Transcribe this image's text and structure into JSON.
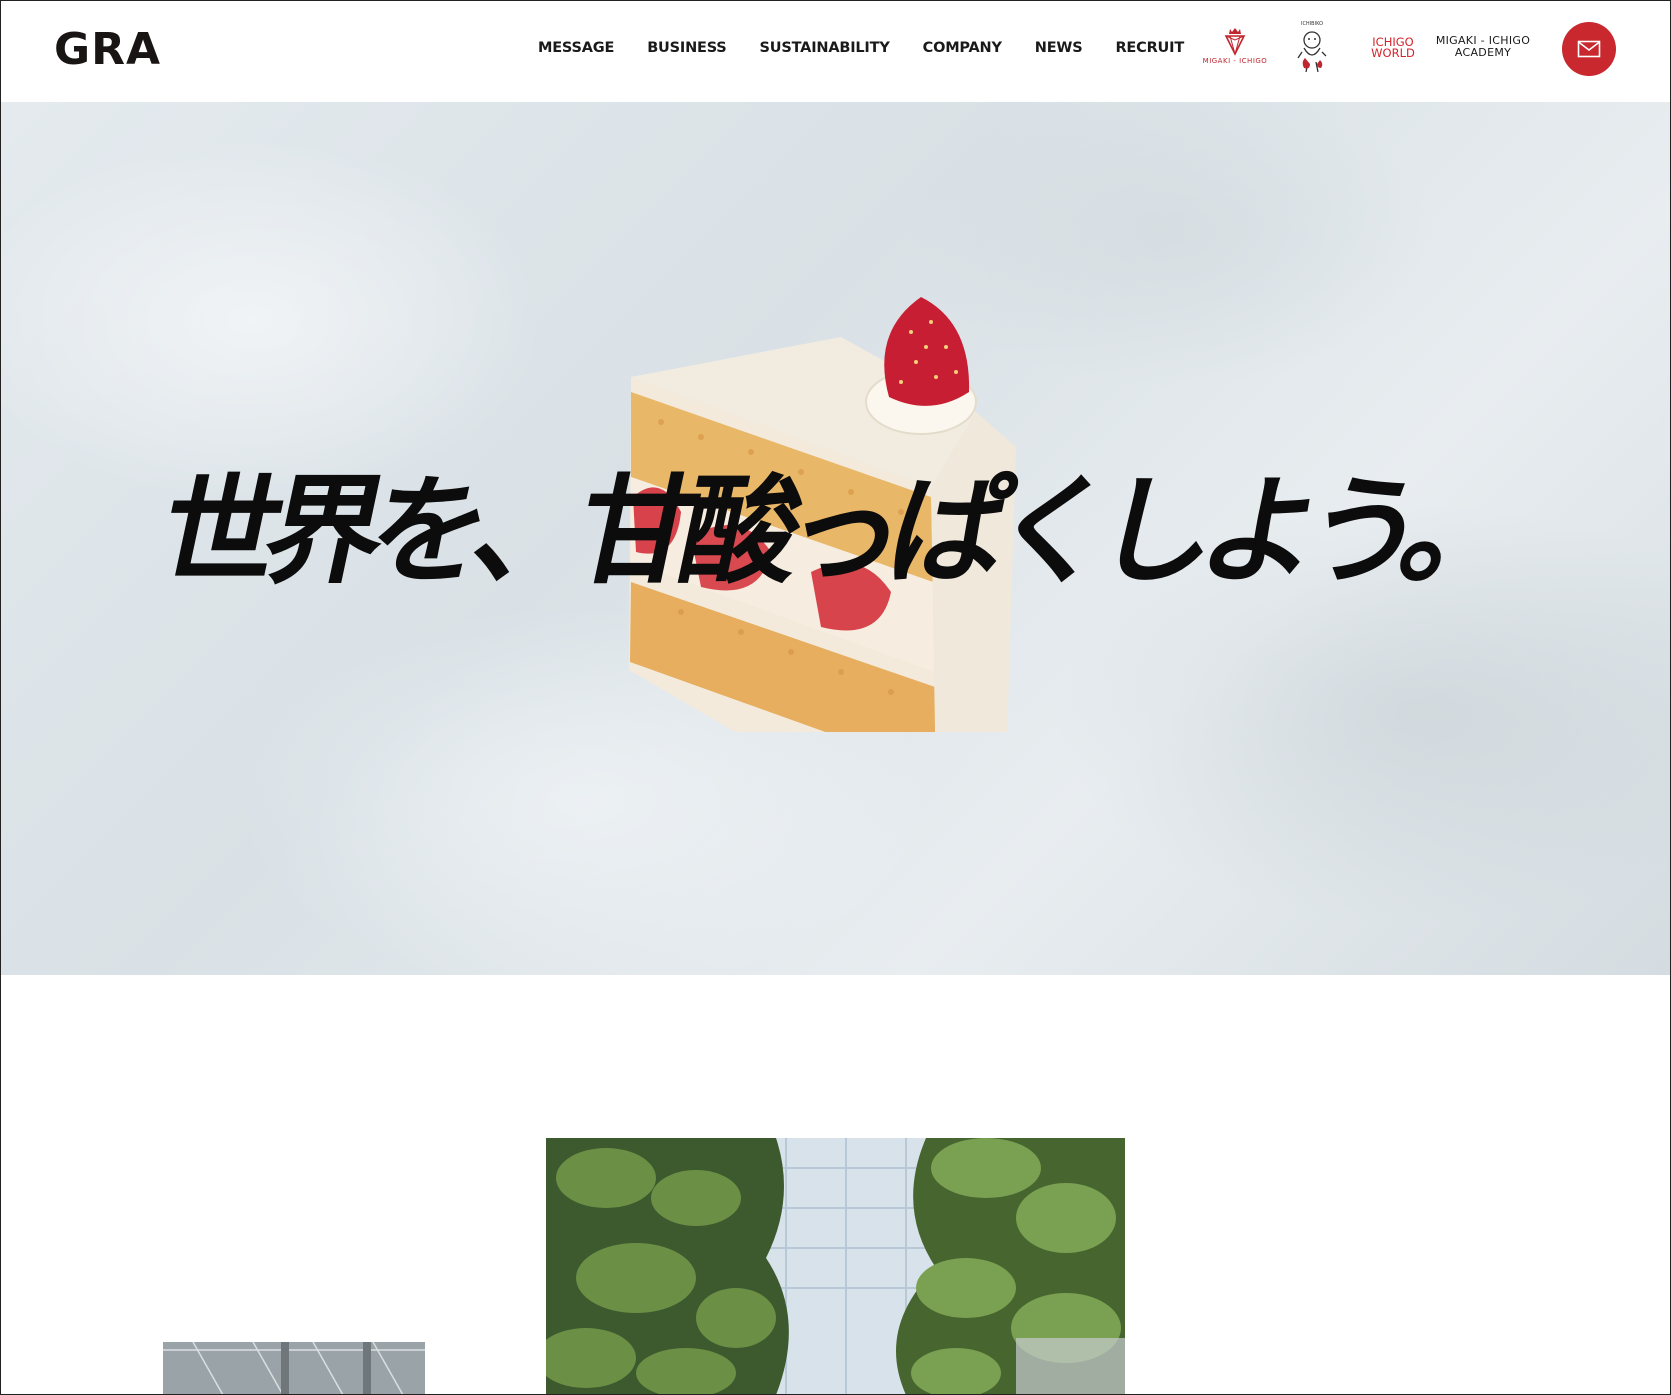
{
  "header": {
    "logo": "GRA",
    "nav": [
      "MESSAGE",
      "BUSINESS",
      "SUSTAINABILITY",
      "COMPANY",
      "NEWS",
      "RECRUIT"
    ],
    "brands": {
      "migaki_ichigo": "MIGAKI - ICHIGO",
      "ichibiko": "ICHIBIKO",
      "ichigo_world_line1": "ICHIGO",
      "ichigo_world_line2": "WORLD",
      "academy_line1": "MIGAKI - ICHIGO",
      "academy_line2": "ACADEMY"
    },
    "contact_icon": "mail-icon"
  },
  "hero": {
    "headline": "世界を、甘酸っぱくしよう。"
  },
  "colors": {
    "accent": "#c8282e",
    "text": "#1a1a1a",
    "hero_bg": "#dfe6ea"
  }
}
